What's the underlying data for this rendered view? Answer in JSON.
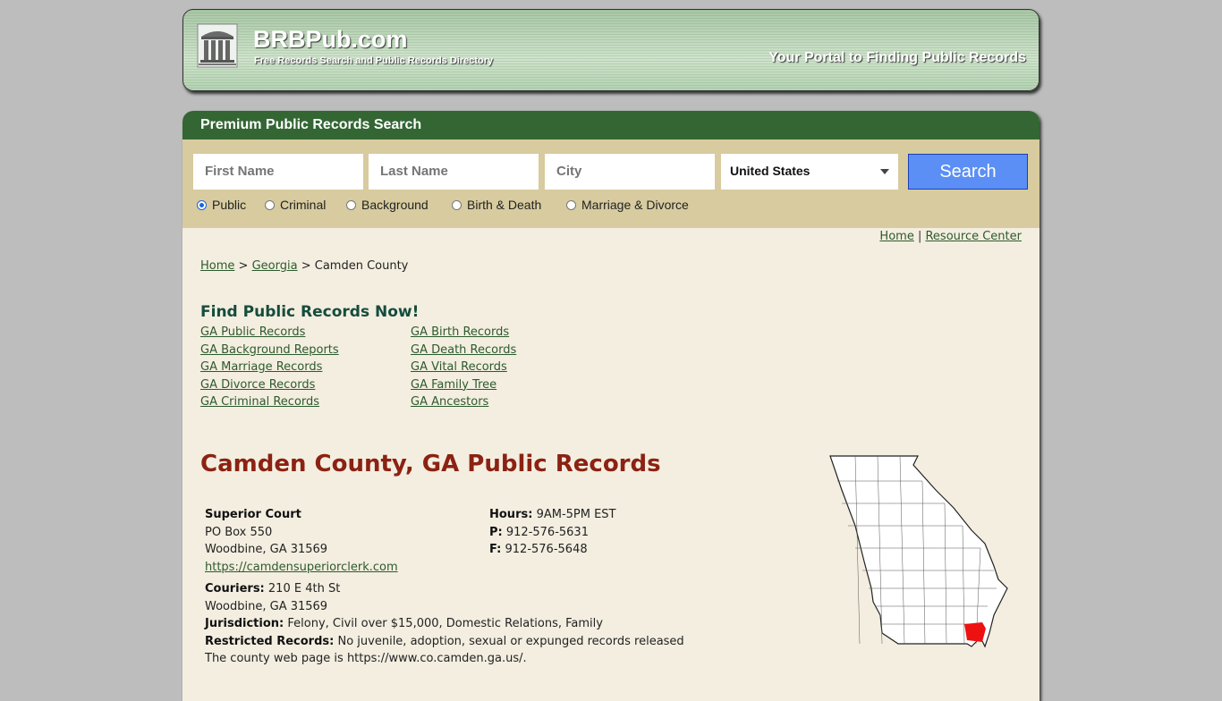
{
  "header": {
    "site_name": "BRBPub.com",
    "tagline": "Free Records Search and Public Records Directory",
    "portal_text": "Your Portal to Finding Public Records",
    "logo_icon": "courthouse-icon"
  },
  "search": {
    "title": "Premium Public Records Search",
    "first_name_placeholder": "First Name",
    "last_name_placeholder": "Last Name",
    "city_placeholder": "City",
    "country_selected": "United States",
    "search_label": "Search",
    "button_color": "#5b8ff5",
    "radios": [
      {
        "label": "Public",
        "checked": true
      },
      {
        "label": "Criminal",
        "checked": false
      },
      {
        "label": "Background",
        "checked": false
      },
      {
        "label": "Birth & Death",
        "checked": false
      },
      {
        "label": "Marriage & Divorce",
        "checked": false
      }
    ]
  },
  "toplinks": {
    "home": "Home",
    "separator": "|",
    "resource": "Resource Center"
  },
  "breadcrumb": {
    "home": "Home",
    "sep": ">",
    "state": "Georgia",
    "current": "Camden County"
  },
  "find": {
    "title": "Find Public Records Now!",
    "left": [
      "GA Public Records",
      "GA Background Reports",
      "GA Marriage Records",
      "GA Divorce Records",
      "GA Criminal Records"
    ],
    "right": [
      "GA Birth Records",
      "GA Death Records",
      "GA Vital Records",
      "GA Family Tree",
      "GA Ancestors"
    ]
  },
  "county": {
    "title": "Camden County, GA Public Records",
    "court_name": "Superior Court",
    "address1": "PO Box 550",
    "address2": "Woodbine, GA 31569",
    "website": "https://camdensuperiorclerk.com",
    "hours_label": "Hours:",
    "hours": "9AM-5PM EST",
    "phone_label": "P:",
    "phone": "912-576-5631",
    "fax_label": "F:",
    "fax": "912-576-5648",
    "couriers_label": "Couriers:",
    "couriers1": "210 E 4th St",
    "couriers2": "Woodbine, GA 31569",
    "jurisdiction_label": "Jurisdiction:",
    "jurisdiction": "Felony, Civil over $15,000, Domestic Relations, Family",
    "restricted_label": "Restricted Records:",
    "restricted": "No juvenile, adoption, sexual or expunged records released",
    "county_web": "The county web page is https://www.co.camden.ga.us/.",
    "highlight_color": "#ee1111"
  }
}
